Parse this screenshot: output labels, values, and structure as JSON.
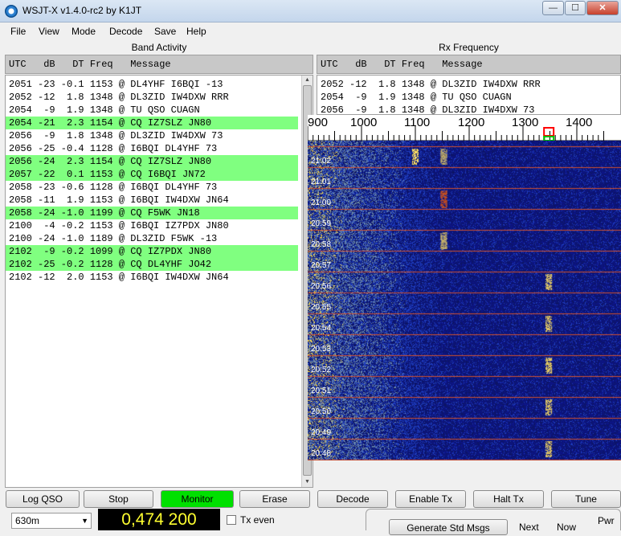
{
  "window": {
    "title": "WSJT-X   v1.4.0-rc2   by K1JT",
    "min": "—",
    "max": "☐",
    "close": "✕"
  },
  "menu": [
    "File",
    "View",
    "Mode",
    "Decode",
    "Save",
    "Help"
  ],
  "band_activity": {
    "title": "Band Activity",
    "header": "UTC   dB   DT Freq   Message",
    "lines": [
      {
        "text": "2051 -23 -0.1 1153 @ DL4YHF I6BQI -13",
        "cq": false
      },
      {
        "text": "2052 -12  1.8 1348 @ DL3ZID IW4DXW RRR",
        "cq": false
      },
      {
        "text": "2054  -9  1.9 1348 @ TU QSO CUAGN",
        "cq": false
      },
      {
        "text": "2054 -21  2.3 1154 @ CQ IZ7SLZ JN80",
        "cq": true
      },
      {
        "text": "2056  -9  1.8 1348 @ DL3ZID IW4DXW 73",
        "cq": false
      },
      {
        "text": "2056 -25 -0.4 1128 @ I6BQI DL4YHF 73",
        "cq": false
      },
      {
        "text": "2056 -24  2.3 1154 @ CQ IZ7SLZ JN80",
        "cq": true
      },
      {
        "text": "2057 -22  0.1 1153 @ CQ I6BQI JN72",
        "cq": true
      },
      {
        "text": "2058 -23 -0.6 1128 @ I6BQI DL4YHF 73",
        "cq": false
      },
      {
        "text": "2058 -11  1.9 1153 @ I6BQI IW4DXW JN64",
        "cq": false
      },
      {
        "text": "2058 -24 -1.0 1199 @ CQ F5WK JN18",
        "cq": true
      },
      {
        "text": "2100  -4 -0.2 1153 @ I6BQI IZ7PDX JN80",
        "cq": false
      },
      {
        "text": "2100 -24 -1.0 1189 @ DL3ZID F5WK -13",
        "cq": false
      },
      {
        "text": "2102  -9 -0.2 1099 @ CQ IZ7PDX JN80",
        "cq": true
      },
      {
        "text": "2102 -25 -0.2 1128 @ CQ DL4YHF JO42",
        "cq": true
      },
      {
        "text": "2102 -12  2.0 1153 @ I6BQI IW4DXW JN64",
        "cq": false
      }
    ]
  },
  "rx_frequency": {
    "title": "Rx Frequency",
    "header": "UTC   dB   DT Freq   Message",
    "lines": [
      "2052 -12  1.8 1348 @ DL3ZID IW4DXW RRR",
      "2054  -9  1.9 1348 @ TU QSO CUAGN",
      "2056  -9  1.8 1348 @ DL3ZID IW4DXW 73"
    ]
  },
  "waterfall": {
    "scale_labels": [
      "900",
      "1000",
      "1100",
      "1200",
      "1300",
      "1400"
    ],
    "scale_min_hz": 900,
    "scale_max_hz": 1450,
    "rx_marker_hz": 1348,
    "times": [
      "21:02",
      "21:01",
      "21:00",
      "20:59",
      "20:58",
      "20:57",
      "20:56",
      "20:55",
      "20:54",
      "20:53",
      "20:52",
      "20:51",
      "20:50",
      "20:49",
      "20:48"
    ],
    "colors": {
      "background": "#0a0f55",
      "separator": "#d05030",
      "signal": "#ffe060",
      "strong": "#ff6000",
      "marker_red": "#ff0000",
      "marker_green": "#00c000"
    }
  },
  "buttons": {
    "log_qso": "Log QSO",
    "stop": "Stop",
    "monitor": "Monitor",
    "erase": "Erase",
    "decode": "Decode",
    "enable_tx": "Enable Tx",
    "halt_tx": "Halt Tx",
    "tune": "Tune"
  },
  "bottom": {
    "band": "630m",
    "frequency": "0,474 200",
    "tx_even": "Tx even",
    "generate": "Generate Std Msgs",
    "next": "Next",
    "now": "Now",
    "pwr": "Pwr"
  }
}
